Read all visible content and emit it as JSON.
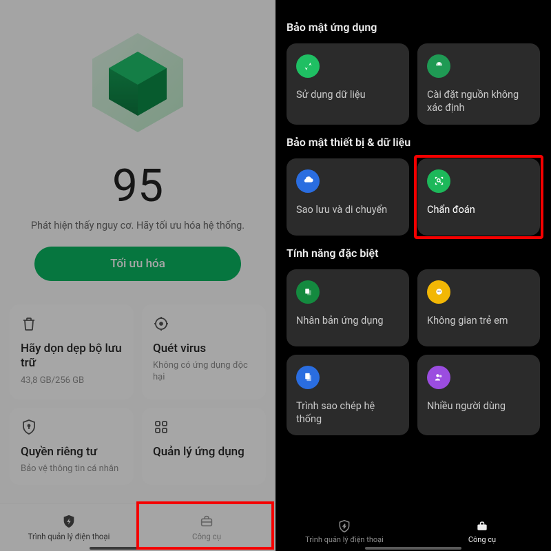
{
  "left": {
    "score": "95",
    "score_subtitle": "Phát hiện thấy nguy cơ. Hãy tối ưu hóa hệ thống.",
    "optimize_label": "Tối ưu hóa",
    "cards": {
      "cleanup": {
        "title": "Hãy dọn dẹp bộ lưu trữ",
        "subtitle": "43,8 GB/256 GB"
      },
      "virus": {
        "title": "Quét virus",
        "subtitle": "Không có ứng dụng độc hại"
      },
      "privacy": {
        "title": "Quyền riêng tư",
        "subtitle": "Bảo vệ thông tin cá nhân"
      },
      "apps": {
        "title": "Quản lý ứng dụng"
      }
    },
    "nav": {
      "manager": "Trình quản lý điện thoại",
      "tools": "Công cụ"
    }
  },
  "right": {
    "sections": {
      "app_sec": "Bảo mật ứng dụng",
      "device_sec": "Bảo mật thiết bị & dữ liệu",
      "special": "Tính năng đặc biệt"
    },
    "cards": {
      "data_usage": "Sử dụng dữ liệu",
      "unknown_src": "Cài đặt nguồn không xác định",
      "backup": "Sao lưu và di chuyển",
      "diagnose": "Chẩn đoán",
      "clone": "Nhân bản ứng dụng",
      "kids": "Không gian trẻ em",
      "sys_clone": "Trình sao chép hệ thống",
      "multi_user": "Nhiều người dùng"
    },
    "nav": {
      "manager": "Trình quản lý điện thoại",
      "tools": "Công cụ"
    }
  }
}
